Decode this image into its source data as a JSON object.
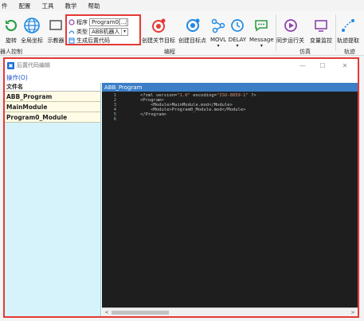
{
  "menubar": {
    "items": [
      {
        "label": "件"
      },
      {
        "label": "配置"
      },
      {
        "label": "工具"
      },
      {
        "label": "教学"
      },
      {
        "label": "帮助"
      }
    ]
  },
  "ribbon": {
    "buttons": {
      "rotate": "旋转",
      "global_coords": "全局坐标",
      "demonstrator": "示教器",
      "create_joint_target": "创建关节目标",
      "create_target": "创建目标点",
      "movl": "MOVL",
      "delay": "DELAY",
      "message": "Message",
      "sync_run": "同步运行关",
      "var_monitor": "变量监控",
      "track_extract": "轨迹提取"
    },
    "combo": {
      "program_label": "程序",
      "program_value": "Program0[...",
      "type_label": "类型",
      "type_value": "ABB机器人",
      "generate_label": "生成后置代码"
    },
    "groups": {
      "robot_control": "器人控制",
      "programming": "编程",
      "simulation": "仿真",
      "trajectory": "轨迹"
    },
    "colors": {
      "accent_red": "#e53935",
      "accent_blue": "#1e88e5",
      "accent_green": "#2e9e47",
      "accent_purple": "#8e44ad"
    }
  },
  "window": {
    "title": "后置代码编辑",
    "menu": "操作(O)",
    "controls": {
      "minimize": "—",
      "maximize": "☐",
      "close": "✕"
    },
    "left_pane": {
      "header": "文件名",
      "rows": [
        "ABB_Program",
        "MainModule",
        "Program0_Module"
      ]
    },
    "code_tab": "ABB_Program",
    "line_numbers": [
      "1",
      "2",
      "3",
      "4",
      "5",
      "6"
    ],
    "code_lines": [
      {
        "a": "<?xml version=",
        "b": "\"1.0\"",
        "c": " encoding=",
        "d": "\"ISO-8859-1\"",
        "e": " ?>"
      },
      {
        "a": "<Program>",
        "b": "",
        "c": "",
        "d": "",
        "e": ""
      },
      {
        "a": "    <Module>MainModule.mod</Module>",
        "b": "",
        "c": "",
        "d": "",
        "e": ""
      },
      {
        "a": "    <Module>Program0_Module.mod</Module>",
        "b": "",
        "c": "",
        "d": "",
        "e": ""
      },
      {
        "a": "</Program>",
        "b": "",
        "c": "",
        "d": "",
        "e": ""
      },
      {
        "a": "",
        "b": "",
        "c": "",
        "d": "",
        "e": ""
      }
    ],
    "scroll": {
      "left": "<",
      "right": ">"
    }
  }
}
